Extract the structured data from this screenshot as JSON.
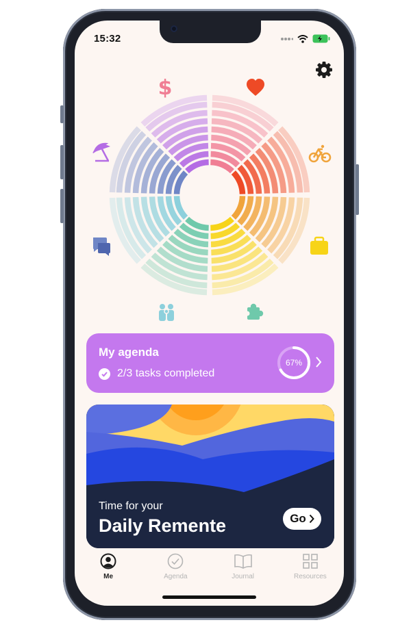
{
  "status_bar": {
    "time": "15:32"
  },
  "icons": {
    "gear": "gear-icon",
    "wheel": [
      "dollar-icon",
      "heart-icon",
      "bicycle-icon",
      "briefcase-icon",
      "puzzle-icon",
      "people-icon",
      "chat-icon",
      "umbrella-icon"
    ]
  },
  "colors": {
    "finance": "#f07e94",
    "health": "#ee4a26",
    "activity": "#f0a43c",
    "work": "#f7d418",
    "growth": "#6fc9ab",
    "family": "#8dd0dc",
    "social": "#6f86c6",
    "leisure": "#b46ce4",
    "agenda_card": "#c478ee"
  },
  "agenda": {
    "title": "My agenda",
    "tasks_text": "2/3 tasks completed",
    "progress_label": "67%",
    "progress": 0.67
  },
  "daily": {
    "small_text": "Time for your",
    "big_text": "Daily Remente",
    "go_label": "Go"
  },
  "tabs": [
    {
      "label": "Me",
      "active": true
    },
    {
      "label": "Agenda",
      "active": false
    },
    {
      "label": "Journal",
      "active": false
    },
    {
      "label": "Resources",
      "active": false
    }
  ]
}
